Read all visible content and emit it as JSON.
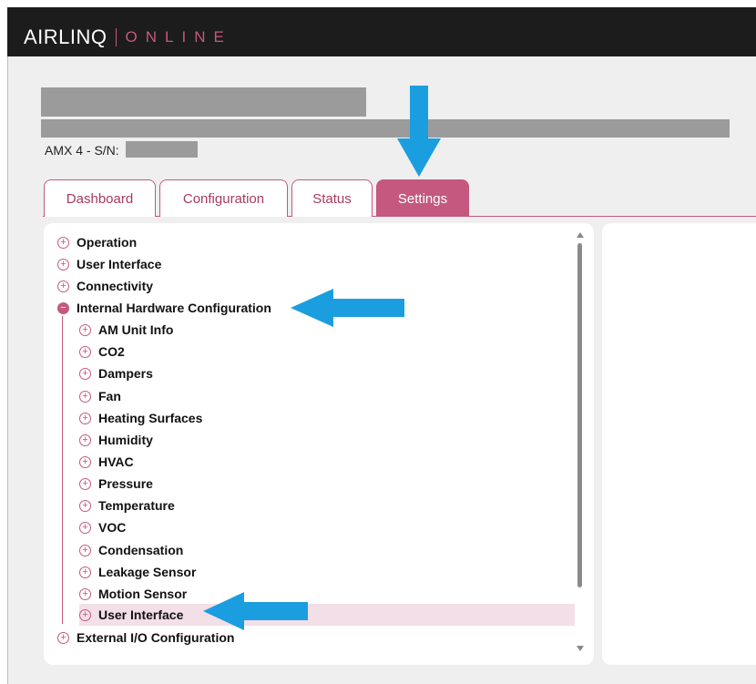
{
  "header": {
    "brand": "AIRLINQ",
    "product": "ONLINE"
  },
  "device": {
    "serial_label": "AMX 4 - S/N:"
  },
  "tabs": [
    {
      "label": "Dashboard",
      "active": false
    },
    {
      "label": "Configuration",
      "active": false
    },
    {
      "label": "Status",
      "active": false
    },
    {
      "label": "Settings",
      "active": true
    }
  ],
  "tree": {
    "top_level": [
      {
        "label": "Operation",
        "expanded": false
      },
      {
        "label": "User Interface",
        "expanded": false
      },
      {
        "label": "Connectivity",
        "expanded": false
      },
      {
        "label": "Internal Hardware Configuration",
        "expanded": true
      }
    ],
    "children": [
      {
        "label": "AM Unit Info"
      },
      {
        "label": "CO2"
      },
      {
        "label": "Dampers"
      },
      {
        "label": "Fan"
      },
      {
        "label": "Heating Surfaces"
      },
      {
        "label": "Humidity"
      },
      {
        "label": "HVAC"
      },
      {
        "label": "Pressure"
      },
      {
        "label": "Temperature"
      },
      {
        "label": "VOC"
      },
      {
        "label": "Condensation"
      },
      {
        "label": "Leakage Sensor"
      },
      {
        "label": "Motion Sensor"
      },
      {
        "label": "User Interface",
        "selected": true
      }
    ],
    "bottom": [
      {
        "label": "External I/O Configuration",
        "expanded": false
      }
    ]
  },
  "colors": {
    "accent": "#c4587f",
    "annotation_arrow": "#1a9ee0",
    "header_bg": "#1c1c1c",
    "selected_row": "#f3dfe8"
  },
  "icons": {
    "collapsed": "plus-circle-icon",
    "expanded": "minus-circle-icon",
    "annotation": "blue-arrow-icon"
  }
}
